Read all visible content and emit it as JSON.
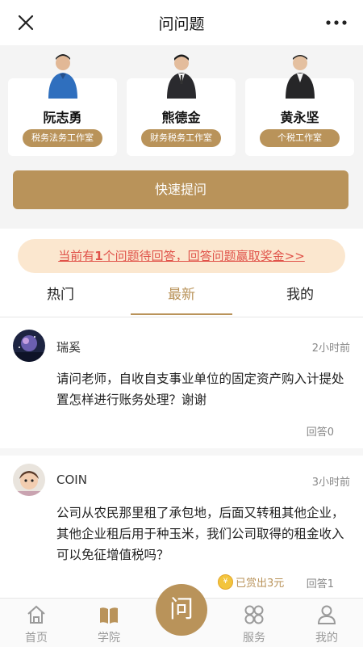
{
  "header": {
    "title": "问问题"
  },
  "teachers": [
    {
      "name": "阮志勇",
      "studio": "税务法务工作室"
    },
    {
      "name": "熊德金",
      "studio": "财务税务工作室"
    },
    {
      "name": "黄永坚",
      "studio": "个税工作室"
    }
  ],
  "quick_ask": "快速提问",
  "notice": {
    "pre": "当前有",
    "count": "1",
    "post": "个问题待回答，回答问题赢取奖金>>"
  },
  "tabs": [
    {
      "label": "热门"
    },
    {
      "label": "最新",
      "active": true
    },
    {
      "label": "我的"
    }
  ],
  "questions": [
    {
      "user": "瑞奚",
      "time": "2小时前",
      "text": "请问老师，自收自支事业单位的固定资产购入计提处置怎样进行账务处理？谢谢",
      "answers": "回答0"
    },
    {
      "user": "COIN",
      "time": "3小时前",
      "text": "公司从农民那里租了承包地，后面又转租其他企业，其他企业租后用于种玉米，我们公司取得的租金收入可以免征增值税吗？",
      "reward": "已赏出3元",
      "answers": "回答1"
    }
  ],
  "nav": {
    "home": "首页",
    "academy": "学院",
    "center": "问",
    "service": "服务",
    "mine": "我的"
  },
  "colors": {
    "accent": "#b9935a",
    "notice_text": "#e0534a",
    "notice_bg": "#fbe7cf"
  }
}
